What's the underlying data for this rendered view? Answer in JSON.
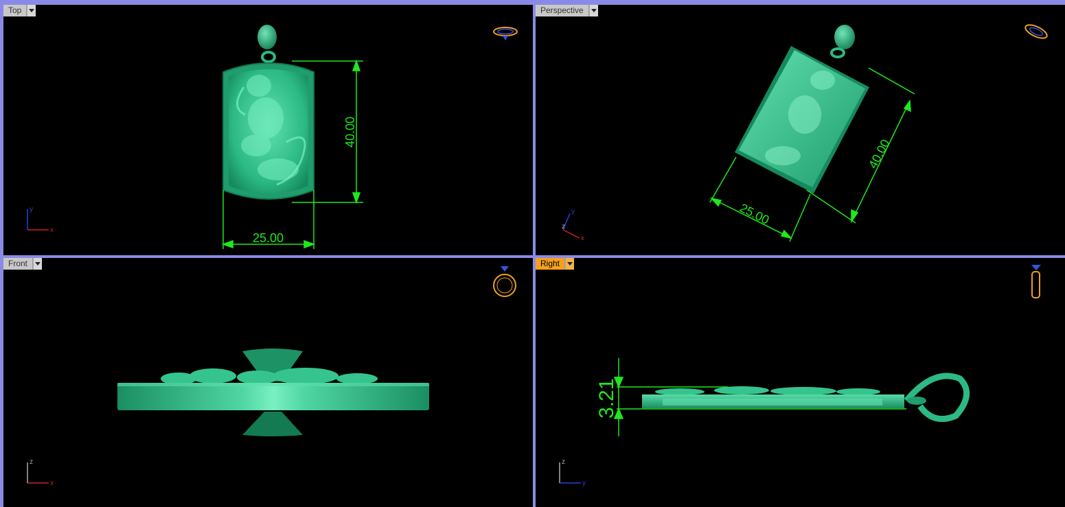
{
  "viewports": {
    "top": {
      "label": "Top",
      "dim_height": "40.00",
      "dim_width": "25.00",
      "axis_x": "x",
      "axis_y": "y"
    },
    "perspective": {
      "label": "Perspective",
      "dim_height": "40.00",
      "dim_width": "25.00",
      "axis_x": "x",
      "axis_y": "y",
      "axis_z": "z"
    },
    "front": {
      "label": "Front",
      "axis_x": "x",
      "axis_z": "z"
    },
    "right": {
      "label": "Right",
      "active": true,
      "dim_thickness": "3.21",
      "axis_y": "y",
      "axis_z": "z"
    }
  },
  "colors": {
    "model": "#2fc08a",
    "dimension": "#1ee81e",
    "active_tab": "#f5a01c",
    "frame": "#8a8ae6"
  },
  "icons": {
    "top": "ring-top-view-icon",
    "perspective": "ring-perspective-view-icon",
    "front": "ring-front-view-icon",
    "right": "ring-side-view-icon"
  }
}
